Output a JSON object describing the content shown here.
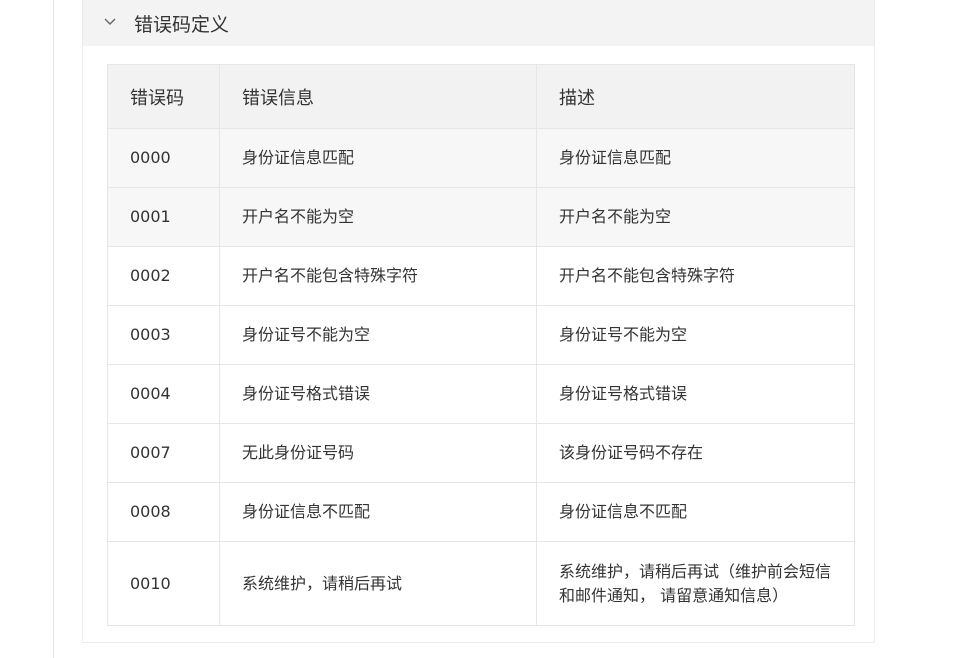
{
  "section": {
    "title": "错误码定义",
    "toggle_icon": "chevron-down-icon"
  },
  "table": {
    "headers": [
      "错误码",
      "错误信息",
      "描述"
    ],
    "rows": [
      {
        "code": "0000",
        "message": "身份证信息匹配",
        "description": "身份证信息匹配"
      },
      {
        "code": "0001",
        "message": "开户名不能为空",
        "description": "开户名不能为空"
      },
      {
        "code": "0002",
        "message": "开户名不能包含特殊字符",
        "description": "开户名不能包含特殊字符"
      },
      {
        "code": "0003",
        "message": "身份证号不能为空",
        "description": "身份证号不能为空"
      },
      {
        "code": "0004",
        "message": "身份证号格式错误",
        "description": "身份证号格式错误"
      },
      {
        "code": "0007",
        "message": "无此身份证号码",
        "description": "该身份证号码不存在"
      },
      {
        "code": "0008",
        "message": "身份证信息不匹配",
        "description": "身份证信息不匹配"
      },
      {
        "code": "0010",
        "message": "系统维护，请稍后再试",
        "description": "系统维护，请稍后再试（维护前会短信和邮件通知， 请留意通知信息）"
      }
    ]
  },
  "colors": {
    "header_background": "#f3f3f3",
    "table_header_background": "#f2f2f2",
    "row_hover_background": "#f7f7f7",
    "border": "#e6e6e6",
    "text": "#333333"
  }
}
